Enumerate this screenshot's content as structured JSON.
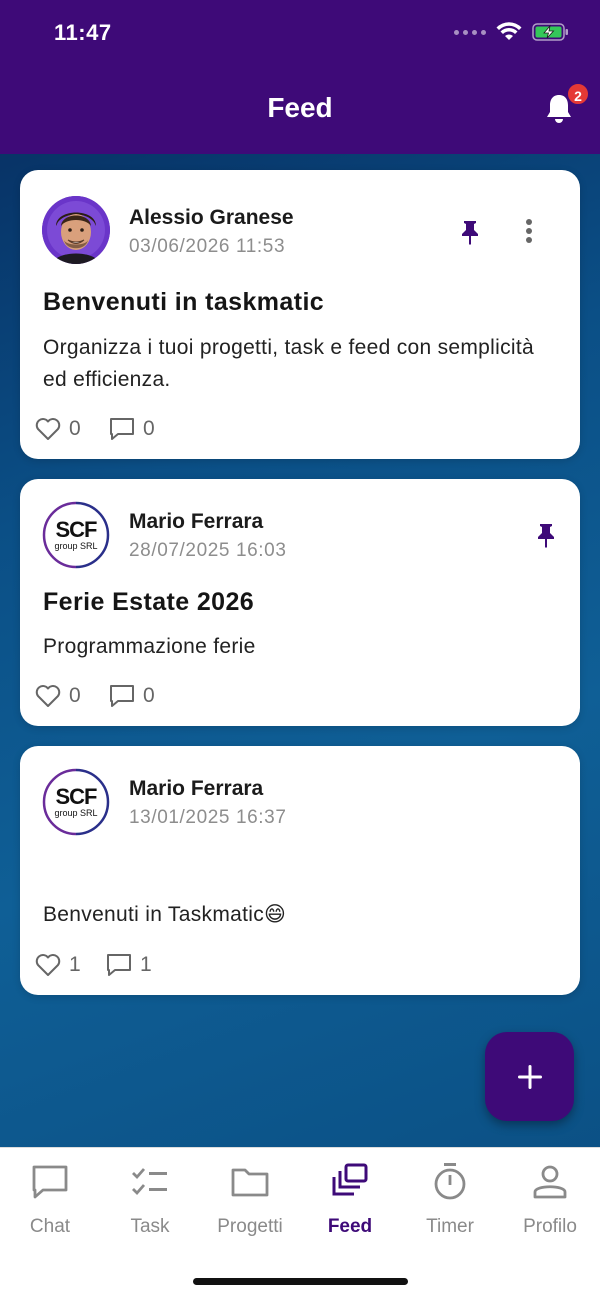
{
  "status_bar": {
    "time": "11:47"
  },
  "header": {
    "title": "Feed",
    "notification_count": "2"
  },
  "posts": [
    {
      "author": "Alessio Granese",
      "datetime": "03/06/2026 11:53",
      "title": "Benvenuti in taskmatic",
      "body": "Organizza i tuoi progetti, task e feed con semplicità ed efficienza.",
      "likes": "0",
      "comments": "0",
      "pinned": true,
      "avatar": "photo"
    },
    {
      "author": "Mario Ferrara",
      "datetime": "28/07/2025 16:03",
      "title": "Ferie Estate 2026",
      "body": "Programmazione ferie",
      "likes": "0",
      "comments": "0",
      "pinned": true,
      "avatar": "scf-logo"
    },
    {
      "author": "Mario Ferrara",
      "datetime": "13/01/2025 16:37",
      "title": "",
      "body": "Benvenuti in Taskmatic😄",
      "likes": "1",
      "comments": "1",
      "pinned": false,
      "avatar": "scf-logo"
    }
  ],
  "logo_text": {
    "main": "SCF",
    "sub": "group SRL"
  },
  "tabs": [
    {
      "label": "Chat",
      "icon": "chat-icon"
    },
    {
      "label": "Task",
      "icon": "checklist-icon"
    },
    {
      "label": "Progetti",
      "icon": "folder-icon"
    },
    {
      "label": "Feed",
      "icon": "feed-icon",
      "active": true
    },
    {
      "label": "Timer",
      "icon": "stopwatch-icon"
    },
    {
      "label": "Profilo",
      "icon": "person-icon"
    }
  ],
  "colors": {
    "primary": "#3e0a78",
    "badge": "#e53935",
    "muted": "#8a8a8a"
  }
}
